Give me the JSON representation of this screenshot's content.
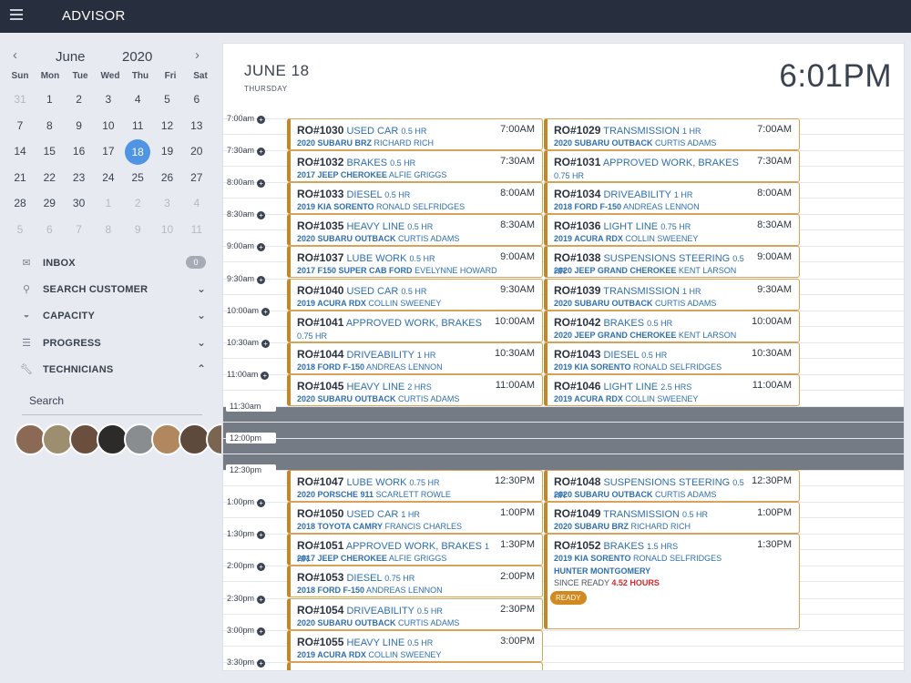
{
  "app": {
    "title": "ADVISOR"
  },
  "calendar": {
    "month": "June",
    "year": "2020",
    "weekdays": [
      "Sun",
      "Mon",
      "Tue",
      "Wed",
      "Thu",
      "Fri",
      "Sat"
    ],
    "weeks": [
      [
        "31",
        "1",
        "2",
        "3",
        "4",
        "5",
        "6"
      ],
      [
        "7",
        "8",
        "9",
        "10",
        "11",
        "12",
        "13"
      ],
      [
        "14",
        "15",
        "16",
        "17",
        "18",
        "19",
        "20"
      ],
      [
        "21",
        "22",
        "23",
        "24",
        "25",
        "26",
        "27"
      ],
      [
        "28",
        "29",
        "30",
        "1",
        "2",
        "3",
        "4"
      ],
      [
        "5",
        "6",
        "7",
        "8",
        "9",
        "10",
        "11"
      ]
    ],
    "selected": "18"
  },
  "menu": {
    "inbox": "INBOX",
    "inbox_count": "0",
    "search_customer": "SEARCH CUSTOMER",
    "capacity": "CAPACITY",
    "progress": "PROGRESS",
    "technicians": "TECHNICIANS"
  },
  "search": {
    "placeholder": "Search"
  },
  "header": {
    "date": "JUNE 18",
    "weekday": "THURSDAY",
    "clock": "6:01PM"
  },
  "times": [
    "7:00am",
    "7:30am",
    "8:00am",
    "8:30am",
    "9:00am",
    "9:30am",
    "10:00am",
    "10:30am",
    "11:00am",
    "11:30am",
    "12:00pm",
    "12:30pm",
    "1:00pm",
    "1:30pm",
    "2:00pm",
    "2:30pm",
    "3:00pm",
    "3:30pm"
  ],
  "col1": [
    {
      "ro": "RO#1030",
      "job": "USED CAR",
      "dur": "0.5 HR",
      "time": "7:00AM",
      "veh": "2020 SUBARU BRZ",
      "cust": "RICHARD RICH"
    },
    {
      "ro": "RO#1032",
      "job": "BRAKES",
      "dur": "0.5 HR",
      "time": "7:30AM",
      "veh": "2017 JEEP CHEROKEE",
      "cust": "ALFIE GRIGGS"
    },
    {
      "ro": "RO#1033",
      "job": "DIESEL",
      "dur": "0.5 HR",
      "time": "8:00AM",
      "veh": "2019 KIA SORENTO",
      "cust": "RONALD SELFRIDGES"
    },
    {
      "ro": "RO#1035",
      "job": "HEAVY LINE",
      "dur": "0.5 HR",
      "time": "8:30AM",
      "veh": "2020 SUBARU OUTBACK",
      "cust": "CURTIS ADAMS"
    },
    {
      "ro": "RO#1037",
      "job": "LUBE WORK",
      "dur": "0.5 HR",
      "time": "9:00AM",
      "veh": "2017 F150 SUPER CAB FORD",
      "cust": "EVELYNNE HOWARD"
    },
    {
      "ro": "RO#1040",
      "job": "USED CAR",
      "dur": "0.5 HR",
      "time": "9:30AM",
      "veh": "2019 ACURA RDX",
      "cust": "COLLIN SWEENEY"
    },
    {
      "ro": "RO#1041",
      "job": "APPROVED WORK, BRAKES",
      "dur": "0.75 HR",
      "time": "10:00AM",
      "veh": "",
      "cust": ""
    },
    {
      "ro": "RO#1044",
      "job": "DRIVEABILITY",
      "dur": "1 HR",
      "time": "10:30AM",
      "veh": "2018 FORD F-150",
      "cust": "ANDREAS LENNON"
    },
    {
      "ro": "RO#1045",
      "job": "HEAVY LINE",
      "dur": "2 HRS",
      "time": "11:00AM",
      "veh": "2020 SUBARU OUTBACK",
      "cust": "CURTIS ADAMS"
    },
    {
      "ro": "RO#1047",
      "job": "LUBE WORK",
      "dur": "0.75 HR",
      "time": "12:30PM",
      "veh": "2020 PORSCHE 911",
      "cust": "SCARLETT ROWLE"
    },
    {
      "ro": "RO#1050",
      "job": "USED CAR",
      "dur": "1 HR",
      "time": "1:00PM",
      "veh": "2018 TOYOTA CAMRY",
      "cust": "FRANCIS CHARLES"
    },
    {
      "ro": "RO#1051",
      "job": "APPROVED WORK, BRAKES",
      "dur": "1 HR",
      "time": "1:30PM",
      "veh": "2017 JEEP CHEROKEE",
      "cust": "ALFIE GRIGGS"
    },
    {
      "ro": "RO#1053",
      "job": "DIESEL",
      "dur": "0.75 HR",
      "time": "2:00PM",
      "veh": "2018 FORD F-150",
      "cust": "ANDREAS LENNON"
    },
    {
      "ro": "RO#1054",
      "job": "DRIVEABILITY",
      "dur": "0.5 HR",
      "time": "2:30PM",
      "veh": "2020 SUBARU OUTBACK",
      "cust": "CURTIS ADAMS"
    },
    {
      "ro": "RO#1055",
      "job": "HEAVY LINE",
      "dur": "0.5 HR",
      "time": "3:00PM",
      "veh": "2019 ACURA RDX",
      "cust": "COLLIN SWEENEY"
    }
  ],
  "col2": [
    {
      "ro": "RO#1029",
      "job": "TRANSMISSION",
      "dur": "1 HR",
      "time": "7:00AM",
      "veh": "2020 SUBARU OUTBACK",
      "cust": "CURTIS ADAMS"
    },
    {
      "ro": "RO#1031",
      "job": "APPROVED WORK, BRAKES",
      "dur": "0.75 HR",
      "time": "7:30AM",
      "veh": "",
      "cust": ""
    },
    {
      "ro": "RO#1034",
      "job": "DRIVEABILITY",
      "dur": "1 HR",
      "time": "8:00AM",
      "veh": "2018 FORD F-150",
      "cust": "ANDREAS LENNON"
    },
    {
      "ro": "RO#1036",
      "job": "LIGHT LINE",
      "dur": "0.75 HR",
      "time": "8:30AM",
      "veh": "2019 ACURA RDX",
      "cust": "COLLIN SWEENEY"
    },
    {
      "ro": "RO#1038",
      "job": "SUSPENSIONS STEERING",
      "dur": "0.5 HR",
      "time": "9:00AM",
      "veh": "2020 JEEP GRAND CHEROKEE",
      "cust": "KENT LARSON"
    },
    {
      "ro": "RO#1039",
      "job": "TRANSMISSION",
      "dur": "1 HR",
      "time": "9:30AM",
      "veh": "2020 SUBARU OUTBACK",
      "cust": "CURTIS ADAMS"
    },
    {
      "ro": "RO#1042",
      "job": "BRAKES",
      "dur": "0.5 HR",
      "time": "10:00AM",
      "veh": "2020 JEEP GRAND CHEROKEE",
      "cust": "KENT LARSON"
    },
    {
      "ro": "RO#1043",
      "job": "DIESEL",
      "dur": "0.5 HR",
      "time": "10:30AM",
      "veh": "2019 KIA SORENTO",
      "cust": "RONALD SELFRIDGES"
    },
    {
      "ro": "RO#1046",
      "job": "LIGHT LINE",
      "dur": "2.5 HRS",
      "time": "11:00AM",
      "veh": "2019 ACURA RDX",
      "cust": "COLLIN SWEENEY"
    },
    {
      "ro": "RO#1048",
      "job": "SUSPENSIONS STEERING",
      "dur": "0.5 HR",
      "time": "12:30PM",
      "veh": "2020 SUBARU OUTBACK",
      "cust": "CURTIS ADAMS"
    },
    {
      "ro": "RO#1049",
      "job": "TRANSMISSION",
      "dur": "0.5 HR",
      "time": "1:00PM",
      "veh": "2020 SUBARU BRZ",
      "cust": "RICHARD RICH"
    },
    {
      "ro": "RO#1052",
      "job": "BRAKES",
      "dur": "1.5 HRS",
      "time": "1:30PM",
      "veh": "2019 KIA SORENTO",
      "cust": "RONALD SELFRIDGES",
      "tech": "HUNTER MONTGOMERY",
      "since_label": "SINCE READY",
      "since_value": "4.52 HOURS",
      "status": "READY"
    }
  ],
  "colors": {
    "topbar": "#272f3e",
    "accent": "#4f95e3",
    "card_border": "#c78626",
    "link": "#2f6fae",
    "lunch": "#747b85",
    "overdue": "#d6282d"
  }
}
